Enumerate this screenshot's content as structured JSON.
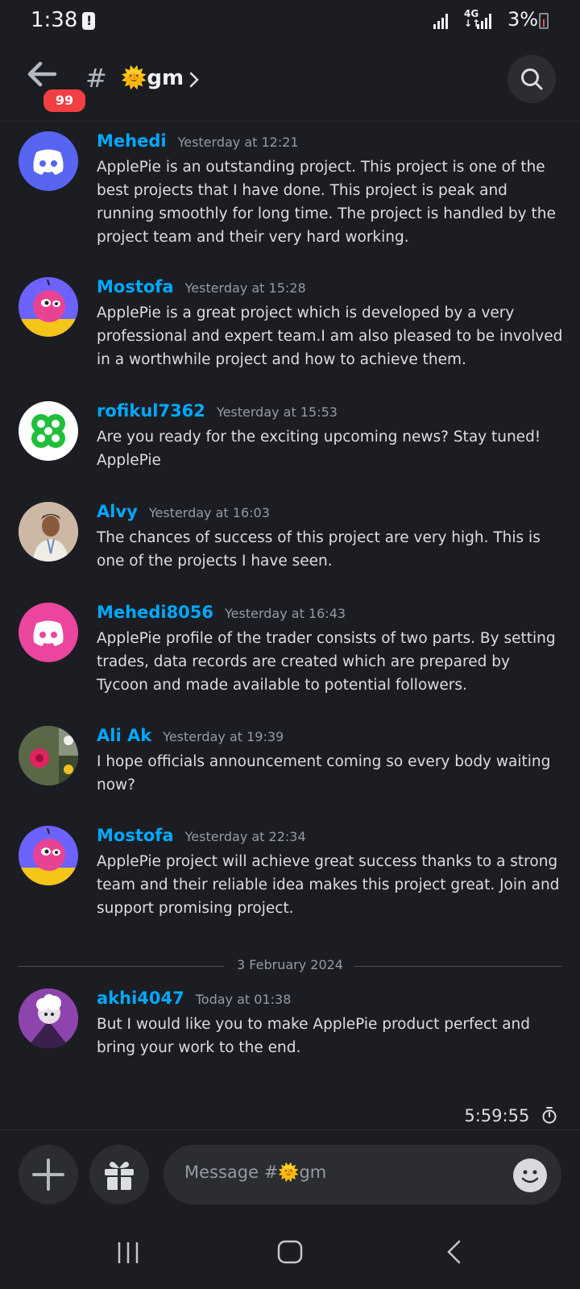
{
  "status_bar": {
    "time": "1:38",
    "network": "4G",
    "battery": "3%"
  },
  "header": {
    "unread_badge": "99",
    "channel_emoji": "🌞",
    "channel_name": "gm"
  },
  "messages": [
    {
      "author": "Mehedi",
      "time": "Yesterday at 12:21",
      "avatar": "discord-logo-icon",
      "avatar_color": "#5865f2",
      "text": "ApplePie is an outstanding project. This project is one of the best projects that I have done. This project is peak and running smoothly for long time. The project is handled by the project team and their very hard working."
    },
    {
      "author": "Mostofa",
      "time": "Yesterday at 15:28",
      "avatar": "pink-creature-avatar",
      "avatar_color": "#6c63ff",
      "text": "ApplePie is a great project which is developed by a very professional and expert team.I am also pleased to be involved in a worthwhile project and how to achieve them."
    },
    {
      "author": "rofikul7362",
      "time": "Yesterday at 15:53",
      "avatar": "green-clover-avatar",
      "avatar_color": "#ffffff",
      "text": "Are you ready for the exciting upcoming news? Stay tuned! ApplePie"
    },
    {
      "author": "Alvy",
      "time": "Yesterday at 16:03",
      "avatar": "person-photo-avatar",
      "avatar_color": "#c9a38a",
      "text": "The chances of success of this project are very high. This is one of the projects I have seen."
    },
    {
      "author": "Mehedi8056",
      "time": "Yesterday at 16:43",
      "avatar": "discord-logo-icon",
      "avatar_color": "#eb459e",
      "text": "ApplePie profile of the trader consists of two parts. By setting trades, data records are created which are prepared by Tycoon and made available to potential followers."
    },
    {
      "author": "Ali Ak",
      "time": "Yesterday at 19:39",
      "avatar": "flower-photo-avatar",
      "avatar_color": "#4a5a3a",
      "text": "I hope officials announcement coming so every body waiting now?"
    },
    {
      "author": "Mostofa",
      "time": "Yesterday at 22:34",
      "avatar": "pink-creature-avatar",
      "avatar_color": "#6c63ff",
      "text": "ApplePie project will achieve great success thanks to a strong team and their reliable idea makes this project great. Join and support promising project."
    },
    {
      "author": "akhi4047",
      "time": "Today at 01:38",
      "avatar": "purple-character-avatar",
      "avatar_color": "#9b59b6",
      "text": "But I would like you to make ApplePie product perfect and bring your work to the end."
    }
  ],
  "date_divider": "3 February 2024",
  "slowmode_timer": "5:59:55",
  "composer": {
    "placeholder": "Message #🌞gm"
  },
  "colors": {
    "background": "#1c1d22",
    "author": "#00a8fc",
    "badge": "#f23f43"
  }
}
